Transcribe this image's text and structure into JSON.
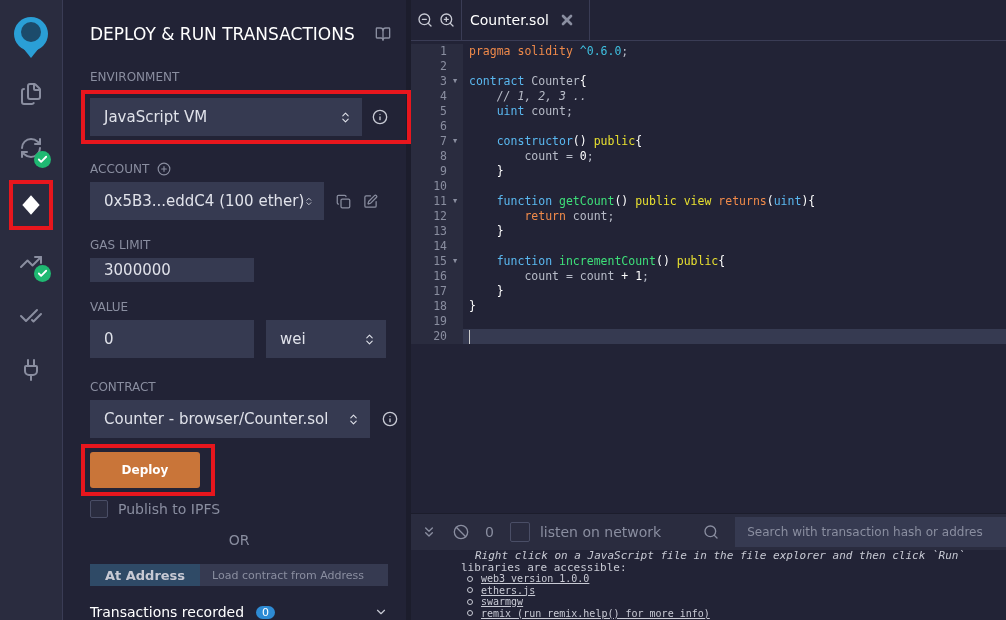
{
  "icon_bar": {
    "items": [
      {
        "kind": "files",
        "selected": false,
        "checked": false
      },
      {
        "kind": "compile",
        "selected": false,
        "checked": true
      },
      {
        "kind": "deploy",
        "selected": true,
        "checked": false
      },
      {
        "kind": "analysis",
        "selected": false,
        "checked": true
      },
      {
        "kind": "test",
        "selected": false,
        "checked": false
      },
      {
        "kind": "plugin",
        "selected": false,
        "checked": false
      }
    ]
  },
  "panel": {
    "title": "DEPLOY & RUN TRANSACTIONS",
    "environment": {
      "label": "ENVIRONMENT",
      "value": "JavaScript VM"
    },
    "account": {
      "label": "ACCOUNT",
      "value": "0x5B3...eddC4 (100 ether)"
    },
    "gas_limit": {
      "label": "GAS LIMIT",
      "value": "3000000"
    },
    "value": {
      "label": "VALUE",
      "amount": "0",
      "unit": "wei"
    },
    "contract": {
      "label": "CONTRACT",
      "value": "Counter - browser/Counter.sol"
    },
    "deploy_button": "Deploy",
    "publish": {
      "label": "Publish to IPFS",
      "checked": false
    },
    "or": "OR",
    "at_address": {
      "button": "At Address",
      "placeholder": "Load contract from Address"
    },
    "transactions": {
      "label": "Transactions recorded",
      "count": "0"
    }
  },
  "editor": {
    "tabs": [
      {
        "label": "Counter.sol",
        "selected": true
      }
    ],
    "lines": [
      {
        "n": "1",
        "active": false,
        "tokens": [
          {
            "t": "pragma solidity ",
            "kind": "keyword"
          },
          {
            "t": "^0.6.0",
            "kind": "version"
          },
          {
            "t": ";",
            "kind": "plain"
          }
        ]
      },
      {
        "n": "2",
        "active": false
      },
      {
        "n": "3",
        "fold": "▼",
        "active": false,
        "tokens": [
          {
            "t": "contract",
            "kind": "type"
          },
          {
            "t": " Counter",
            "kind": "plain"
          },
          {
            "t": "{",
            "kind": "punct"
          }
        ]
      },
      {
        "n": "4",
        "active": false,
        "tokens": [
          {
            "t": "    // 1, 2, 3 ..",
            "kind": "comment"
          }
        ]
      },
      {
        "n": "5",
        "active": false,
        "tokens": [
          {
            "t": "    uint",
            "kind": "type"
          },
          {
            "t": " count;",
            "kind": "plain"
          }
        ]
      },
      {
        "n": "6",
        "active": false
      },
      {
        "n": "7",
        "fold": "▼",
        "active": false,
        "tokens": [
          {
            "t": "    constructor",
            "kind": "type"
          },
          {
            "t": "() ",
            "kind": "punct"
          },
          {
            "t": "public",
            "kind": "modifier"
          },
          {
            "t": "{",
            "kind": "punct"
          }
        ]
      },
      {
        "n": "8",
        "active": false,
        "tokens": [
          {
            "t": "        count = ",
            "kind": "plain"
          },
          {
            "t": "0",
            "kind": "number"
          },
          {
            "t": ";",
            "kind": "plain"
          }
        ]
      },
      {
        "n": "9",
        "active": false,
        "tokens": [
          {
            "t": "    }",
            "kind": "punct"
          }
        ]
      },
      {
        "n": "10",
        "active": false
      },
      {
        "n": "11",
        "fold": "▼",
        "active": false,
        "tokens": [
          {
            "t": "    function ",
            "kind": "type"
          },
          {
            "t": "getCount",
            "kind": "function"
          },
          {
            "t": "() ",
            "kind": "punct"
          },
          {
            "t": "public view ",
            "kind": "modifier"
          },
          {
            "t": "returns",
            "kind": "keyword"
          },
          {
            "t": "(",
            "kind": "punct"
          },
          {
            "t": "uint",
            "kind": "type"
          },
          {
            "t": "){",
            "kind": "punct"
          }
        ]
      },
      {
        "n": "12",
        "active": false,
        "tokens": [
          {
            "t": "        return",
            "kind": "keyword"
          },
          {
            "t": " count;",
            "kind": "plain"
          }
        ]
      },
      {
        "n": "13",
        "active": false,
        "tokens": [
          {
            "t": "    }",
            "kind": "punct"
          }
        ]
      },
      {
        "n": "14",
        "active": false
      },
      {
        "n": "15",
        "fold": "▼",
        "active": false,
        "tokens": [
          {
            "t": "    function ",
            "kind": "type"
          },
          {
            "t": "incrementCount",
            "kind": "function"
          },
          {
            "t": "() ",
            "kind": "punct"
          },
          {
            "t": "public",
            "kind": "modifier"
          },
          {
            "t": "{",
            "kind": "punct"
          }
        ]
      },
      {
        "n": "16",
        "active": false,
        "tokens": [
          {
            "t": "        count = count ",
            "kind": "plain"
          },
          {
            "t": "+ 1",
            "kind": "number"
          },
          {
            "t": ";",
            "kind": "plain"
          }
        ]
      },
      {
        "n": "17",
        "active": false,
        "tokens": [
          {
            "t": "    }",
            "kind": "punct"
          }
        ]
      },
      {
        "n": "18",
        "active": false,
        "tokens": [
          {
            "t": "}",
            "kind": "punct"
          }
        ]
      },
      {
        "n": "19",
        "active": false
      },
      {
        "n": "20",
        "active": true
      }
    ]
  },
  "terminal": {
    "count": "0",
    "listen": {
      "label": "listen on network",
      "checked": false
    },
    "search_placeholder": "Search with transaction hash or addres",
    "intro": "Right click on a JavaScript file in the file explorer and then click `Run`",
    "libraries": "libraries are accessible:",
    "links": [
      "web3 version 1.0.0",
      "ethers.js",
      "swarmgw",
      "remix (run remix.help() for more info)"
    ]
  }
}
